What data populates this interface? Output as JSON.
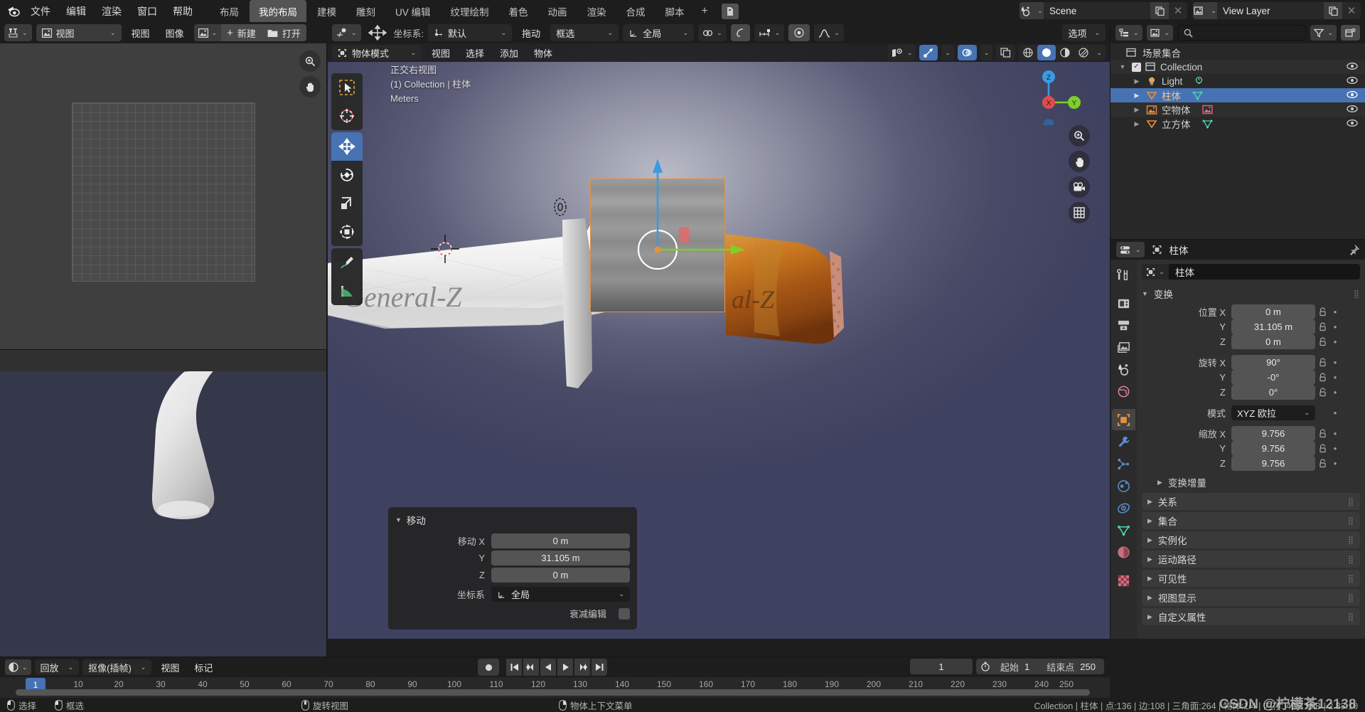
{
  "app": {
    "logo": "blender-logo",
    "menus": [
      "文件",
      "编辑",
      "渲染",
      "窗口",
      "帮助"
    ],
    "workspace_tabs": [
      {
        "label": "布局",
        "active": false
      },
      {
        "label": "我的布局",
        "active": true
      },
      {
        "label": "建模",
        "active": false
      },
      {
        "label": "雕刻",
        "active": false
      },
      {
        "label": "UV 编辑",
        "active": false
      },
      {
        "label": "纹理绘制",
        "active": false
      },
      {
        "label": "着色",
        "active": false
      },
      {
        "label": "动画",
        "active": false
      },
      {
        "label": "渲染",
        "active": false
      },
      {
        "label": "合成",
        "active": false
      },
      {
        "label": "脚本",
        "active": false
      }
    ],
    "add_workspace": "+",
    "scene": {
      "name": "Scene",
      "icon": "scene-icon"
    },
    "view_layer": {
      "name": "View Layer",
      "icon": "view-layer-icon"
    }
  },
  "image_editor": {
    "editor_type_icon": "uv-editor-icon",
    "mode": "视图",
    "menus": [
      "视图",
      "图像"
    ],
    "image_icon": "image-icon",
    "new_button": "新建",
    "open_button": "打开"
  },
  "panel2": {
    "transform_orientation_label": "",
    "orientation_value": "默认",
    "drag_label": "拖动",
    "drag_value": "框选",
    "snap_space": "全局"
  },
  "tool_settings": {
    "active_tool_icon": "move-tool-icon",
    "orientation_label": "坐标系:",
    "orientation_value": "默认",
    "drag_label": "拖动",
    "drag_value": "框选",
    "snap_space": "全局",
    "options_label": "选项"
  },
  "viewport": {
    "mode": "物体模式",
    "menus": [
      "视图",
      "选择",
      "添加",
      "物体"
    ],
    "overlay": {
      "view_name": "正交右视图",
      "collection_object": "(1) Collection | 柱体",
      "units": "Meters"
    },
    "gizmo_axes": {
      "x": "X",
      "y": "Y",
      "z": "Z"
    },
    "tools": [
      {
        "name": "tweak-tool",
        "label": "选择"
      },
      {
        "name": "cursor-tool",
        "label": "游标"
      },
      {
        "name": "move-tool",
        "label": "移动",
        "active": true
      },
      {
        "name": "rotate-tool",
        "label": "旋转"
      },
      {
        "name": "scale-tool",
        "label": "缩放"
      },
      {
        "name": "transform-tool",
        "label": "变换"
      },
      {
        "name": "annotate-tool",
        "label": "标注"
      },
      {
        "name": "measure-tool",
        "label": "测量"
      }
    ],
    "nav_buttons": [
      "zoom-icon",
      "pan-hand-icon",
      "camera-icon",
      "grid-icon"
    ]
  },
  "redo_panel": {
    "title": "移动",
    "fields": [
      {
        "label": "移动 X",
        "value": "0 m"
      },
      {
        "label": "Y",
        "value": "31.105 m"
      },
      {
        "label": "Z",
        "value": "0 m"
      }
    ],
    "orientation_label": "坐标系",
    "orientation_value": "全局",
    "proportional_label": "衰减编辑",
    "proportional_checked": false
  },
  "outliner": {
    "display_mode_icon": "outliner-icon",
    "filter_icon": "filter-icon",
    "new_collection_icon": "new-collection-icon",
    "search_placeholder": "",
    "root": "场景集合",
    "rows": [
      {
        "label": "Collection",
        "icon": "collection-icon",
        "depth": 1,
        "checkbox": true,
        "expanded": true,
        "selected": false,
        "data_icon": null
      },
      {
        "label": "Light",
        "icon": "light-object-icon",
        "depth": 2,
        "selected": false,
        "data_icon": "light-data-icon"
      },
      {
        "label": "柱体",
        "icon": "mesh-object-icon",
        "depth": 2,
        "selected": true,
        "data_icon": "mesh-data-icon"
      },
      {
        "label": "空物体",
        "icon": "empty-image-object-icon",
        "depth": 2,
        "selected": false,
        "data_icon": "image-data-icon"
      },
      {
        "label": "立方体",
        "icon": "mesh-object-icon",
        "depth": 2,
        "selected": false,
        "data_icon": "mesh-data-icon"
      }
    ]
  },
  "properties": {
    "editor_icon": "properties-icon",
    "breadcrumb_object": "柱体",
    "pin_icon": "pin-icon",
    "object_name": "柱体",
    "tabs": [
      {
        "name": "tool-tab",
        "active": false
      },
      {
        "name": "render-tab",
        "active": false
      },
      {
        "name": "output-tab",
        "active": false
      },
      {
        "name": "view-layer-tab",
        "active": false
      },
      {
        "name": "scene-tab",
        "active": false
      },
      {
        "name": "world-tab",
        "active": false
      },
      {
        "name": "object-tab",
        "active": true
      },
      {
        "name": "modifier-tab",
        "active": false
      },
      {
        "name": "particles-tab",
        "active": false
      },
      {
        "name": "physics-tab",
        "active": false
      },
      {
        "name": "constraints-tab",
        "active": false
      },
      {
        "name": "data-tab",
        "active": false
      },
      {
        "name": "material-tab",
        "active": false
      },
      {
        "name": "texture-tab",
        "active": false
      }
    ],
    "transform": {
      "title": "变换",
      "location_label": "位置",
      "location": [
        {
          "axis": "X",
          "value": "0 m"
        },
        {
          "axis": "Y",
          "value": "31.105 m"
        },
        {
          "axis": "Z",
          "value": "0 m"
        }
      ],
      "rotation_label": "旋转",
      "rotation": [
        {
          "axis": "X",
          "value": "90°"
        },
        {
          "axis": "Y",
          "value": "-0°"
        },
        {
          "axis": "Z",
          "value": "0°"
        }
      ],
      "mode_label": "模式",
      "mode_value": "XYZ 欧拉",
      "scale_label": "缩放",
      "scale": [
        {
          "axis": "X",
          "value": "9.756"
        },
        {
          "axis": "Y",
          "value": "9.756"
        },
        {
          "axis": "Z",
          "value": "9.756"
        }
      ],
      "delta_transform": "变换增量"
    },
    "sections": [
      "关系",
      "集合",
      "实例化",
      "运动路径",
      "可见性",
      "视图显示",
      "自定义属性"
    ]
  },
  "timeline": {
    "editor_icon": "timeline-icon",
    "playback_menu": "回放",
    "keying_menu": "抠像(插帧)",
    "menus": [
      "视图",
      "标记"
    ],
    "current_frame": "1",
    "start_label": "起始",
    "start_value": "1",
    "end_label": "结束点",
    "end_value": "250",
    "ticks": [
      10,
      20,
      30,
      40,
      50,
      60,
      70,
      80,
      90,
      100,
      110,
      120,
      130,
      140,
      150,
      160,
      170,
      180,
      190,
      200,
      210,
      220,
      230,
      240,
      250
    ],
    "playhead_frame": "1"
  },
  "status_bar": {
    "hints": [
      {
        "icon": "mouse-left-icon",
        "label": "选择"
      },
      {
        "icon": "mouse-left-drag-icon",
        "label": "框选"
      },
      {
        "icon": "mouse-middle-icon",
        "label": "旋转视图"
      },
      {
        "icon": "mouse-right-icon",
        "label": "物体上下文菜单"
      }
    ],
    "scene_stats": "Collection | 柱体 | 点:136 | 边:108 | 三角面:264 | 物体:1/4 | 内存: 42.3 MiB | 2.83.10"
  },
  "watermark": "CSDN @柠檬茶12138",
  "colors": {
    "accent_blue": "#4772b3",
    "selection_orange": "#e8913b",
    "axis_x": "#e04c4c",
    "axis_y": "#7ecf28",
    "axis_z": "#3b9ae1",
    "panel_bg": "#303030",
    "header_bg": "#1d1d1d"
  }
}
